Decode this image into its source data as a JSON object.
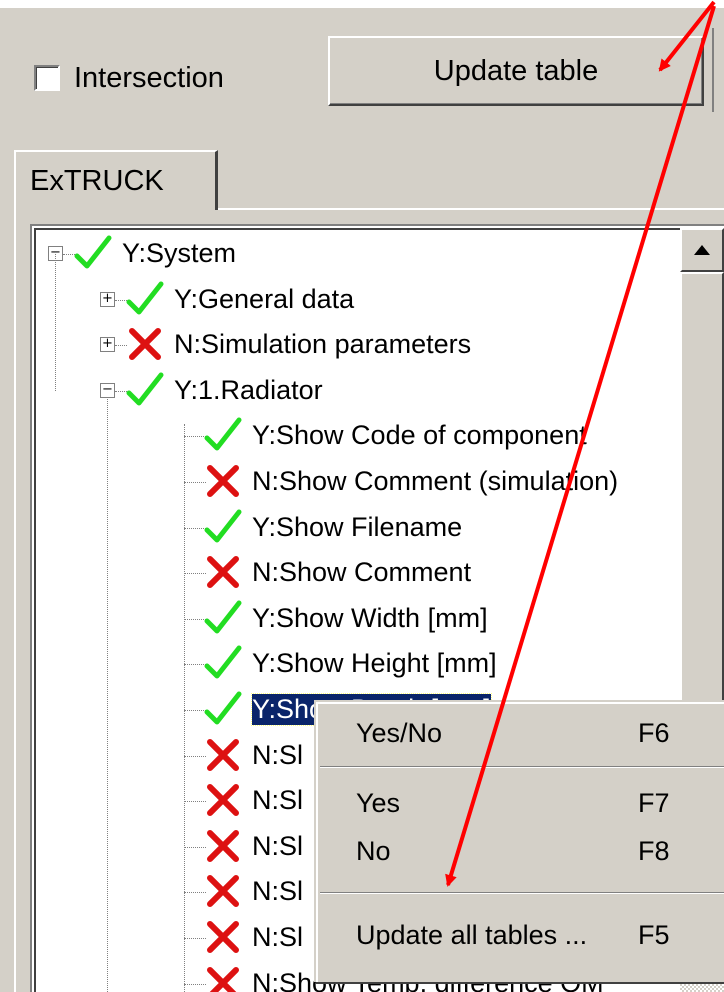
{
  "toolbar": {
    "intersection_label": "Intersection",
    "intersection_checked": false,
    "update_table_label": "Update table"
  },
  "tabs": [
    {
      "label": "ExTRUCK",
      "active": true
    }
  ],
  "tree": {
    "items": [
      {
        "label": "Y:System",
        "status": "yes",
        "expander": "−"
      },
      {
        "label": "Y:General data",
        "status": "yes",
        "expander": "+"
      },
      {
        "label": "N:Simulation parameters",
        "status": "no",
        "expander": "+"
      },
      {
        "label": "Y:1.Radiator",
        "status": "yes",
        "expander": "−"
      },
      {
        "label": "Y:Show Code of component",
        "status": "yes"
      },
      {
        "label": "N:Show Comment (simulation)",
        "status": "no"
      },
      {
        "label": "Y:Show Filename",
        "status": "yes"
      },
      {
        "label": "N:Show Comment",
        "status": "no"
      },
      {
        "label": "Y:Show Width [mm]",
        "status": "yes"
      },
      {
        "label": "Y:Show Height [mm]",
        "status": "yes"
      },
      {
        "label": "Y:Show Depth [mm]",
        "status": "yes",
        "selected": true
      },
      {
        "label": "N:Sl",
        "status": "no"
      },
      {
        "label": "N:Sl",
        "status": "no"
      },
      {
        "label": "N:Sl",
        "status": "no"
      },
      {
        "label": "N:Sl",
        "status": "no"
      },
      {
        "label": "N:Sl",
        "status": "no"
      },
      {
        "label": "N:Show Temp. difference OM",
        "status": "no"
      }
    ]
  },
  "context_menu": {
    "items": [
      {
        "label": "Yes/No",
        "shortcut": "F6"
      },
      {
        "label": "Yes",
        "shortcut": "F7"
      },
      {
        "label": "No",
        "shortcut": "F8"
      },
      {
        "label": "Update all tables ...",
        "shortcut": "F5"
      }
    ]
  },
  "colors": {
    "face": "#d4d0c8",
    "selection": "#0a246a",
    "check": "#22dd22",
    "cross": "#dd1111",
    "annotation_arrow": "#ff0000"
  },
  "icons": {
    "yes": "green-check-icon",
    "no": "red-x-icon",
    "scroll_up": "scroll-up-arrow-icon"
  }
}
